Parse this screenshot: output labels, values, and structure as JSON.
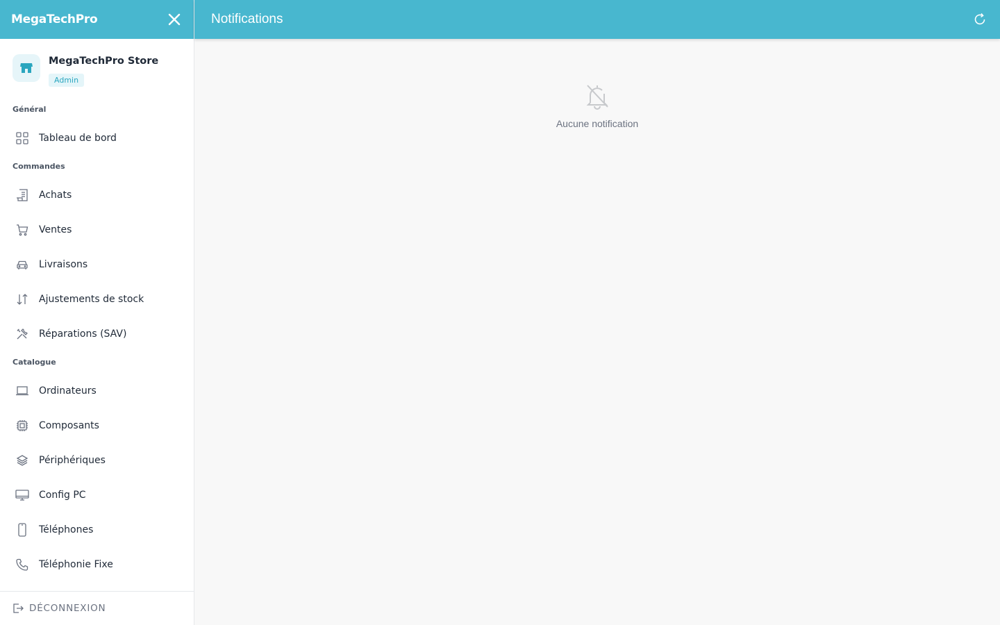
{
  "app": {
    "brand": "MegaTechPro",
    "accent": "#48b7cf"
  },
  "store": {
    "name": "MegaTechPro Store",
    "role": "Admin"
  },
  "sidebar": {
    "sections": [
      {
        "label": "Général"
      },
      {
        "label": "Commandes"
      },
      {
        "label": "Catalogue"
      }
    ],
    "items": [
      {
        "label": "Tableau de bord",
        "icon": "grid-icon"
      },
      {
        "label": "Achats",
        "icon": "receipt-icon"
      },
      {
        "label": "Ventes",
        "icon": "cart-icon"
      },
      {
        "label": "Livraisons",
        "icon": "car-icon"
      },
      {
        "label": "Ajustements de stock",
        "icon": "arrows-updown-icon"
      },
      {
        "label": "Réparations (SAV)",
        "icon": "tools-icon"
      },
      {
        "label": "Ordinateurs",
        "icon": "laptop-icon"
      },
      {
        "label": "Composants",
        "icon": "chip-icon"
      },
      {
        "label": "Périphériques",
        "icon": "layers-icon"
      },
      {
        "label": "Config PC",
        "icon": "monitor-icon"
      },
      {
        "label": "Téléphones",
        "icon": "smartphone-icon"
      },
      {
        "label": "Téléphonie Fixe",
        "icon": "phone-icon"
      }
    ],
    "logout": "DÉCONNEXION"
  },
  "header": {
    "title": "Notifications"
  },
  "main": {
    "empty_text": "Aucune notification"
  }
}
